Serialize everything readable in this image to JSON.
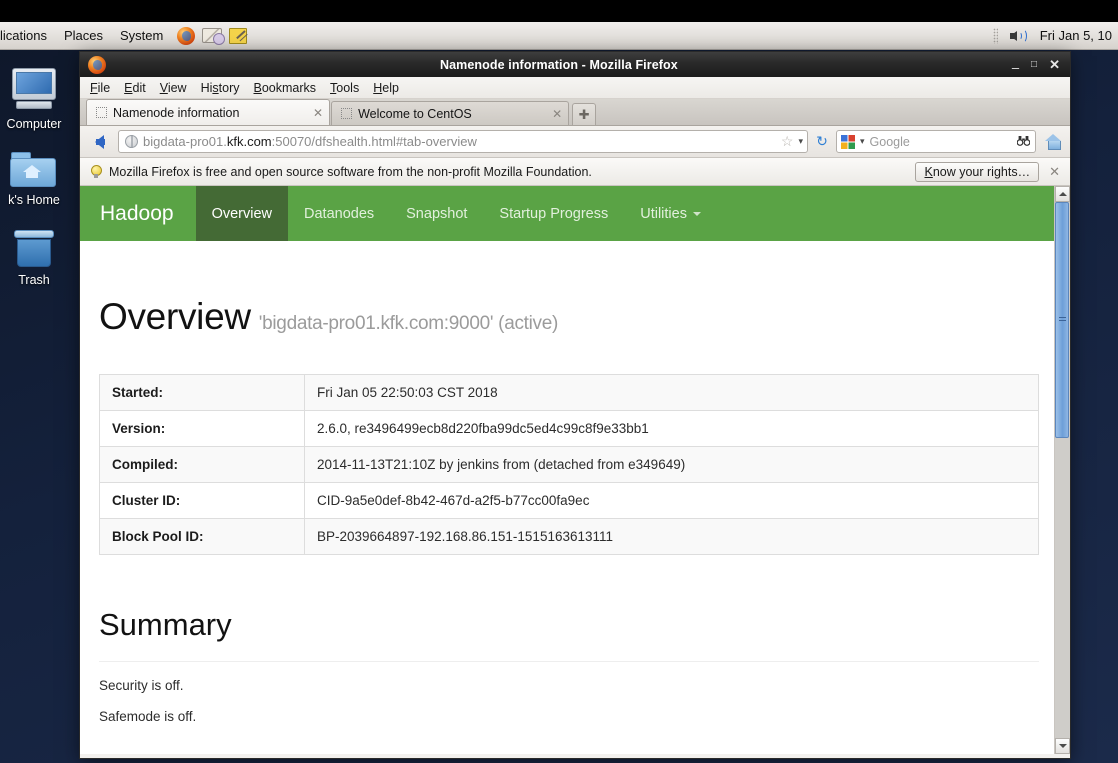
{
  "desktop": {
    "icons": [
      {
        "name": "Computer",
        "label": "Computer"
      },
      {
        "name": "home",
        "label": "k's Home"
      },
      {
        "name": "Trash",
        "label": "Trash"
      }
    ]
  },
  "panel": {
    "menus": [
      "lications",
      "Places",
      "System"
    ],
    "launchers": [
      "firefox-icon",
      "evolution-mail-icon",
      "text-editor-icon"
    ],
    "tray": [
      "volume-icon"
    ],
    "clock": "Fri Jan  5, 10"
  },
  "window": {
    "title": "Namenode information - Mozilla Firefox",
    "controls": {
      "minimize": "–",
      "maximize": "□",
      "close": "✕"
    }
  },
  "menubar": [
    {
      "pre": "",
      "key": "F",
      "post": "ile"
    },
    {
      "pre": "",
      "key": "E",
      "post": "dit"
    },
    {
      "pre": "",
      "key": "V",
      "post": "iew"
    },
    {
      "pre": "Hi",
      "key": "s",
      "post": "tory"
    },
    {
      "pre": "",
      "key": "B",
      "post": "ookmarks"
    },
    {
      "pre": "",
      "key": "T",
      "post": "ools"
    },
    {
      "pre": "",
      "key": "H",
      "post": "elp"
    }
  ],
  "tabs": {
    "items": [
      {
        "label": "Namenode information",
        "active": true,
        "close": "✕"
      },
      {
        "label": "Welcome to CentOS",
        "active": false,
        "close": "✕"
      }
    ],
    "new_tab": "✚"
  },
  "toolbar": {
    "back_tooltip": "Back",
    "url_prefix": "bigdata-pro01.",
    "url_domain": "kfk.com",
    "url_suffix": ":50070/dfshealth.html#tab-overview",
    "url_full": "bigdata-pro01.kfk.com:50070/dfshealth.html#tab-overview",
    "bookmark_star": "☆",
    "dropdown_caret": "▾",
    "reload": "↻",
    "search_engine": "Google",
    "search_placeholder": "Google",
    "search_button": "🔭",
    "home_tooltip": "Home"
  },
  "notification": {
    "text": "Mozilla Firefox is free and open source software from the non-profit Mozilla Foundation.",
    "button_key": "K",
    "button_rest": "now your rights…",
    "close": "✕"
  },
  "hadoop": {
    "brand": "Hadoop",
    "nav": [
      {
        "label": "Overview",
        "active": true
      },
      {
        "label": "Datanodes",
        "active": false
      },
      {
        "label": "Snapshot",
        "active": false
      },
      {
        "label": "Startup Progress",
        "active": false
      },
      {
        "label": "Utilities",
        "active": false,
        "caret": true
      }
    ],
    "heading": "Overview",
    "heading_sub": "'bigdata-pro01.kfk.com:9000' (active)",
    "info_rows": [
      {
        "key": "Started:",
        "value": "Fri Jan 05 22:50:03 CST 2018"
      },
      {
        "key": "Version:",
        "value": "2.6.0, re3496499ecb8d220fba99dc5ed4c99c8f9e33bb1"
      },
      {
        "key": "Compiled:",
        "value": "2014-11-13T21:10Z by jenkins from (detached from e349649)"
      },
      {
        "key": "Cluster ID:",
        "value": "CID-9a5e0def-8b42-467d-a2f5-b77cc00fa9ec"
      },
      {
        "key": "Block Pool ID:",
        "value": "BP-2039664897-192.168.86.151-1515163613111"
      }
    ],
    "summary_heading": "Summary",
    "summary_lines": [
      "Security is off.",
      "Safemode is off."
    ]
  },
  "scrollbar": {
    "up": "▴",
    "down": "▾",
    "thumb_position_pct": 0
  },
  "colors": {
    "hadoop_green": "#5aa345",
    "hadoop_green_active": "#446a35",
    "desktop_blue": "#14213c",
    "titlebar": "#2b2b2b"
  }
}
